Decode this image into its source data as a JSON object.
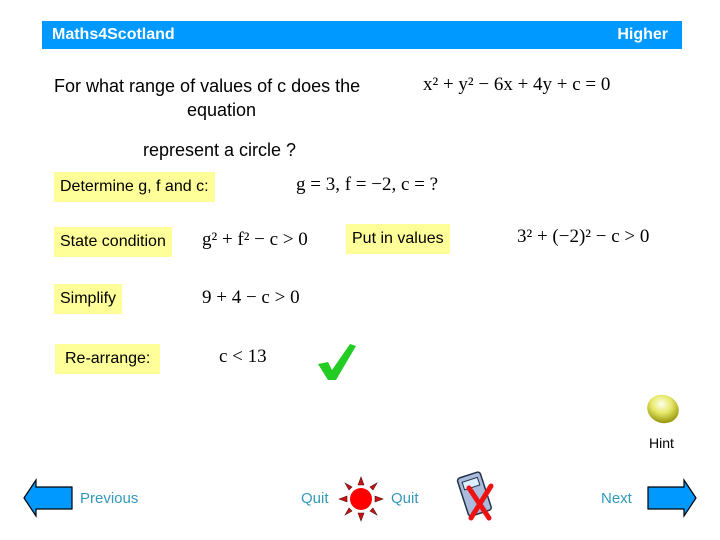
{
  "header": {
    "brand": "Maths4Scotland",
    "level": "Higher",
    "color": "#0099ff"
  },
  "question": {
    "line1": "For what range of values of  c  does the",
    "line2": "equation",
    "line3": "represent a circle ?",
    "equation": "x² + y² − 6x + 4y + c = 0"
  },
  "steps": [
    {
      "label": "Determine g, f and c:",
      "math": "g = 3,   f = −2,   c = ?"
    },
    {
      "label": "State condition",
      "math": "g² + f² − c > 0"
    },
    {
      "label": "Put in values",
      "math": "3² + (−2)² − c > 0"
    },
    {
      "label": "Simplify",
      "math": "9 + 4 − c > 0"
    },
    {
      "label": "Re-arrange:",
      "math": "c < 13"
    }
  ],
  "icons": {
    "check": "checkmark-icon",
    "hint": "hint-bulb-icon",
    "quit": "sun-quit-icon",
    "calculator": "calculator-crossed-icon"
  },
  "nav": {
    "previous": "Previous",
    "quit_left": "Quit",
    "quit_right": "Quit",
    "next": "Next",
    "hint": "Hint"
  },
  "colors": {
    "box": "#ffff99",
    "arrow": "#0099ff",
    "check": "#22cc22",
    "quit": "#ff0000",
    "nav_text": "#3399bb"
  }
}
